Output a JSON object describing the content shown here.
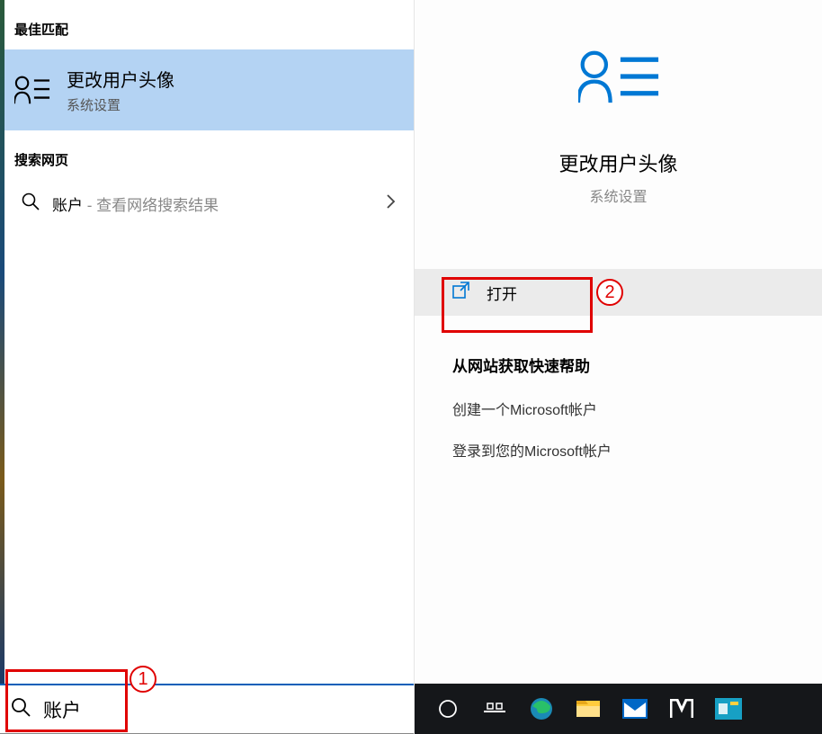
{
  "left": {
    "best_match_header": "最佳匹配",
    "best_match": {
      "title": "更改用户头像",
      "subtitle": "系统设置"
    },
    "web_header": "搜索网页",
    "web_item": {
      "label": "账户",
      "hint": " - 查看网络搜索结果"
    },
    "search": {
      "value": "账户"
    }
  },
  "right": {
    "title": "更改用户头像",
    "subtitle": "系统设置",
    "action_label": "打开",
    "help_header": "从网站获取快速帮助",
    "help_links": [
      "创建一个Microsoft帐户",
      "登录到您的Microsoft帐户"
    ]
  },
  "annotations": {
    "step1": "1",
    "step2": "2"
  },
  "colors": {
    "accent": "#0078d4",
    "selected_bg": "#b4d3f3",
    "annotation": "#e00000"
  }
}
